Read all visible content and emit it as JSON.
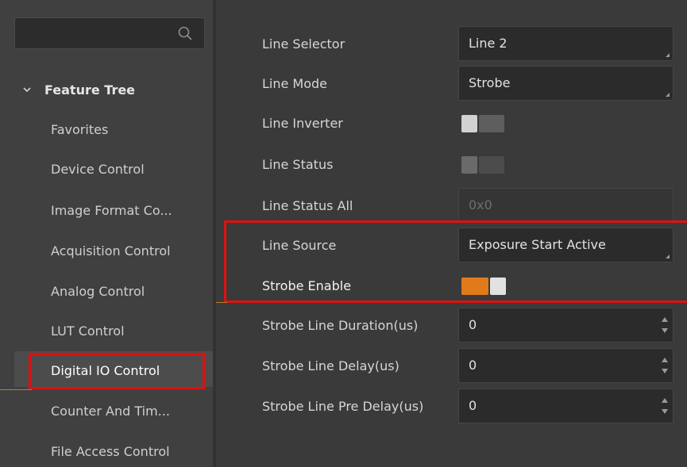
{
  "search": {
    "placeholder": ""
  },
  "tree": {
    "title": "Feature Tree",
    "items": [
      "Favorites",
      "Device Control",
      "Image Format Co...",
      "Acquisition Control",
      "Analog Control",
      "LUT Control",
      "Digital IO Control",
      "Counter And Tim...",
      "File Access Control"
    ],
    "selected_index": 6
  },
  "properties": {
    "line_selector": {
      "label": "Line Selector",
      "value": "Line 2"
    },
    "line_mode": {
      "label": "Line Mode",
      "value": "Strobe"
    },
    "line_inverter": {
      "label": "Line Inverter",
      "on": false
    },
    "line_status": {
      "label": "Line Status",
      "on": false
    },
    "line_status_all": {
      "label": "Line Status All",
      "value": "0x0"
    },
    "line_source": {
      "label": "Line Source",
      "value": "Exposure Start Active"
    },
    "strobe_enable": {
      "label": "Strobe Enable",
      "on": true
    },
    "strobe_line_duration": {
      "label": "Strobe Line Duration(us)",
      "value": "0"
    },
    "strobe_line_delay": {
      "label": "Strobe Line Delay(us)",
      "value": "0"
    },
    "strobe_line_pre_delay": {
      "label": "Strobe Line Pre Delay(us)",
      "value": "0"
    }
  },
  "colors": {
    "highlight": "#e01010",
    "toggle_on": "#e07a1a",
    "background": "#3a3a3a"
  }
}
